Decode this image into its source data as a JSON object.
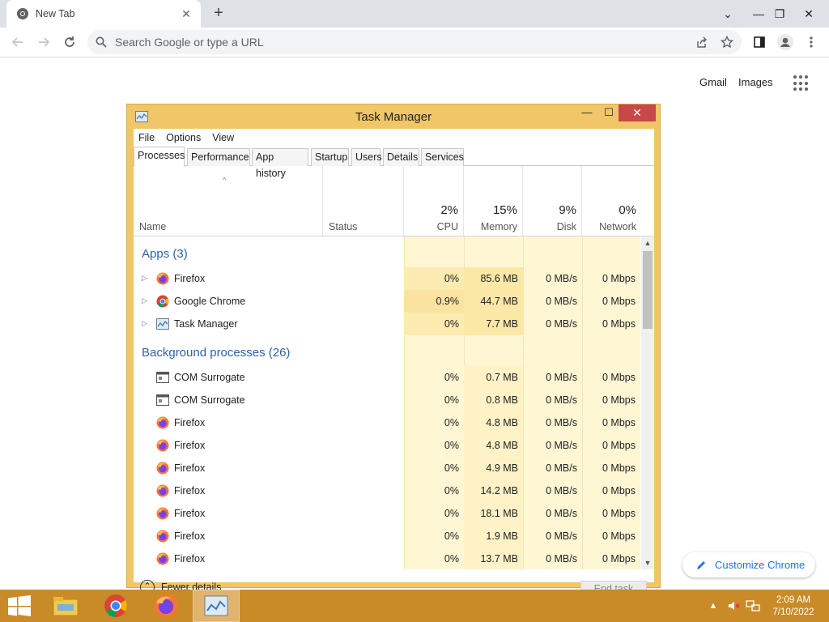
{
  "browser": {
    "tab_title": "New Tab",
    "omnibox_placeholder": "Search Google or type a URL",
    "ntp_links": {
      "gmail": "Gmail",
      "images": "Images"
    },
    "customize_label": "Customize Chrome"
  },
  "task_manager": {
    "title": "Task Manager",
    "menu": [
      "File",
      "Options",
      "View"
    ],
    "tabs": [
      "Processes",
      "Performance",
      "App history",
      "Startup",
      "Users",
      "Details",
      "Services"
    ],
    "active_tab": "Processes",
    "columns": {
      "name": "Name",
      "status": "Status",
      "cpu": {
        "label": "CPU",
        "pct": "2%"
      },
      "memory": {
        "label": "Memory",
        "pct": "15%"
      },
      "disk": {
        "label": "Disk",
        "pct": "9%"
      },
      "network": {
        "label": "Network",
        "pct": "0%"
      }
    },
    "groups": {
      "apps": "Apps (3)",
      "background": "Background processes (26)"
    },
    "apps": [
      {
        "name": "Firefox",
        "icon": "firefox-icon",
        "cpu": "0%",
        "memory": "85.6 MB",
        "disk": "0 MB/s",
        "network": "0 Mbps"
      },
      {
        "name": "Google Chrome",
        "icon": "chrome-icon",
        "cpu": "0.9%",
        "memory": "44.7 MB",
        "disk": "0 MB/s",
        "network": "0 Mbps"
      },
      {
        "name": "Task Manager",
        "icon": "task-manager-icon",
        "cpu": "0%",
        "memory": "7.7 MB",
        "disk": "0 MB/s",
        "network": "0 Mbps"
      }
    ],
    "background": [
      {
        "name": "COM Surrogate",
        "icon": "com-surrogate-icon",
        "cpu": "0%",
        "memory": "0.7 MB",
        "disk": "0 MB/s",
        "network": "0 Mbps"
      },
      {
        "name": "COM Surrogate",
        "icon": "com-surrogate-icon",
        "cpu": "0%",
        "memory": "0.8 MB",
        "disk": "0 MB/s",
        "network": "0 Mbps"
      },
      {
        "name": "Firefox",
        "icon": "firefox-icon",
        "cpu": "0%",
        "memory": "4.8 MB",
        "disk": "0 MB/s",
        "network": "0 Mbps"
      },
      {
        "name": "Firefox",
        "icon": "firefox-icon",
        "cpu": "0%",
        "memory": "4.8 MB",
        "disk": "0 MB/s",
        "network": "0 Mbps"
      },
      {
        "name": "Firefox",
        "icon": "firefox-icon",
        "cpu": "0%",
        "memory": "4.9 MB",
        "disk": "0 MB/s",
        "network": "0 Mbps"
      },
      {
        "name": "Firefox",
        "icon": "firefox-icon",
        "cpu": "0%",
        "memory": "14.2 MB",
        "disk": "0 MB/s",
        "network": "0 Mbps"
      },
      {
        "name": "Firefox",
        "icon": "firefox-icon",
        "cpu": "0%",
        "memory": "18.1 MB",
        "disk": "0 MB/s",
        "network": "0 Mbps"
      },
      {
        "name": "Firefox",
        "icon": "firefox-icon",
        "cpu": "0%",
        "memory": "1.9 MB",
        "disk": "0 MB/s",
        "network": "0 Mbps"
      },
      {
        "name": "Firefox",
        "icon": "firefox-icon",
        "cpu": "0%",
        "memory": "13.7 MB",
        "disk": "0 MB/s",
        "network": "0 Mbps"
      }
    ],
    "fewer_details": "Fewer details",
    "end_task": "End task"
  },
  "taskbar": {
    "clock_time": "2:09 AM",
    "clock_date": "7/10/2022"
  },
  "colors": {
    "taskbar": "#c98b27",
    "tm_frame": "#f0c668",
    "heat": "#fff6d4",
    "accent_blue": "#1a73e8",
    "group_blue": "#2e62a8"
  }
}
